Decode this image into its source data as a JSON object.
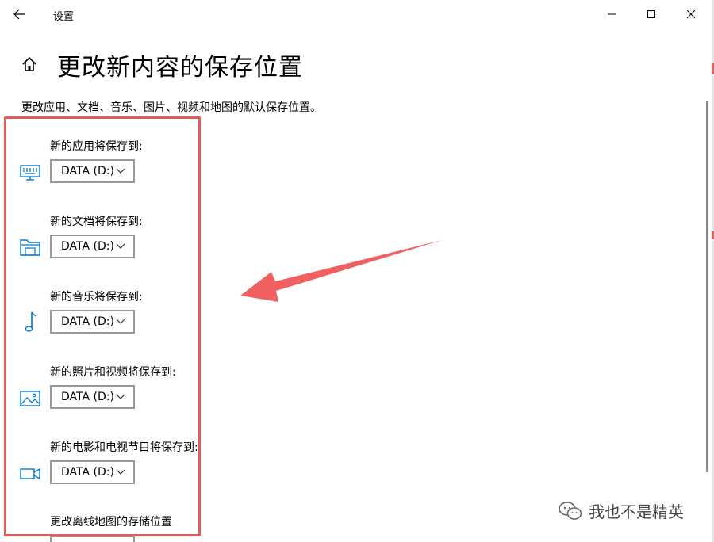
{
  "window": {
    "title": "设置"
  },
  "header": {
    "title": "更改新内容的保存位置"
  },
  "description": "更改应用、文档、音乐、图片、视频和地图的默认保存位置。",
  "settings": [
    {
      "label": "新的应用将保存到:",
      "value": "DATA (D:)",
      "icon": "monitor-icon"
    },
    {
      "label": "新的文档将保存到:",
      "value": "DATA (D:)",
      "icon": "folder-icon"
    },
    {
      "label": "新的音乐将保存到:",
      "value": "DATA (D:)",
      "icon": "music-note-icon"
    },
    {
      "label": "新的照片和视频将保存到:",
      "value": "DATA (D:)",
      "icon": "picture-icon"
    },
    {
      "label": "新的电影和电视节目将保存到:",
      "value": "DATA (D:)",
      "icon": "video-camera-icon"
    },
    {
      "label": "更改离线地图的存储位置",
      "icon": "none"
    }
  ],
  "watermark": "我也不是精英",
  "colors": {
    "accent": "#0078d7",
    "annotation": "#e55a5a",
    "dropdown_border": "#999999"
  }
}
